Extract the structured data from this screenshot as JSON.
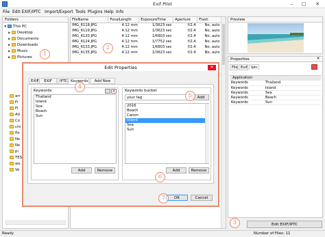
{
  "window": {
    "title": "Exif Pilot",
    "minimize": "–",
    "maximize": "□",
    "close": "✕"
  },
  "menu": [
    "File",
    "Edit EXIF/IPTC",
    "Import/Export",
    "Tools",
    "Plugins",
    "Help",
    "Info"
  ],
  "folders": {
    "header": "Folders",
    "items": [
      {
        "label": "This PC",
        "exp": "▼",
        "icon": "pc"
      },
      {
        "label": "Desktop",
        "exp": "▶",
        "icon": "folder"
      },
      {
        "label": "Documents",
        "exp": "▶",
        "icon": "folder"
      },
      {
        "label": "Downloads",
        "exp": "▶",
        "icon": "folder"
      },
      {
        "label": "Music",
        "exp": "▶",
        "icon": "folder"
      },
      {
        "label": "Pictures",
        "exp": "▶",
        "icon": "folder"
      }
    ],
    "partial_items": [
      "arr",
      "Fi",
      "Fl",
      "AU",
      "Co",
      "cro",
      "flo",
      "Ne",
      "Ne",
      "pi",
      "TES",
      "wo",
      "Ve"
    ]
  },
  "files": {
    "columns": [
      "FileName",
      "FocalLength",
      "ExposureTime",
      "Aperture",
      "Flash"
    ],
    "rows": [
      [
        "IMG_6118.JPG",
        "4.12 mm",
        "1/3623 sec",
        "f/2.4",
        "No, auto"
      ],
      [
        "IMG_6119.JPG",
        "4.12 mm",
        "1/3623 sec",
        "f/2.4",
        "No, auto"
      ],
      [
        "IMG_6120.JPG",
        "4.12 mm",
        "1/6803 sec",
        "f/2.4",
        "No, auto"
      ],
      [
        "IMG_6124.JPG",
        "4.12 mm",
        "1/7752 sec",
        "f/2.4",
        "No, auto"
      ],
      [
        "IMG_6133.JPG",
        "4.12 mm",
        "1/6803 sec",
        "f/2.4",
        "No, auto"
      ],
      [
        "IMG_6135.JPG",
        "4.12 mm",
        "1/3623 sec",
        "f/2.4",
        "No, auto"
      ]
    ]
  },
  "preview": {
    "header": "Preview"
  },
  "properties": {
    "header": "Properties",
    "tabs": [
      "File",
      "Exif",
      "Iptc"
    ],
    "section": "Application",
    "rows": [
      [
        "Keywords",
        "Thailand"
      ],
      [
        "Keywords",
        "Island"
      ],
      [
        "Keywords",
        "Sea"
      ],
      [
        "Keywords",
        "Beach"
      ],
      [
        "Keywords",
        "Sun"
      ]
    ],
    "edit_button": "Edit EXIF/IPTC"
  },
  "dialog": {
    "title": "Edit Properties",
    "tabs": [
      "EXIF",
      "EXIF GPS",
      "IPTC",
      "Keywords",
      "Add New Tags"
    ],
    "keywords_label": "Keywords",
    "keywords": [
      "Thailand",
      "Island",
      "Sea",
      "Beach",
      "Sun"
    ],
    "bucket_label": "Keywords bucket",
    "tag_input": "your tag",
    "bucket_add": "Add",
    "bucket": [
      "2016",
      "Beach",
      "Canon",
      "Island",
      "Sea",
      "Sun"
    ],
    "bucket_selected": 3,
    "left_add": "Add",
    "left_remove": "Remove",
    "right_add": "Add",
    "right_remove": "Remove",
    "ok": "OK",
    "cancel": "Cancel"
  },
  "badges": [
    "1",
    "2",
    "3",
    "4",
    "5",
    "6",
    "7"
  ],
  "status": {
    "left": "Ready",
    "right": "Number of Files: 11"
  },
  "colors": {
    "accent": "#e8886a",
    "selection": "#3399ff"
  }
}
